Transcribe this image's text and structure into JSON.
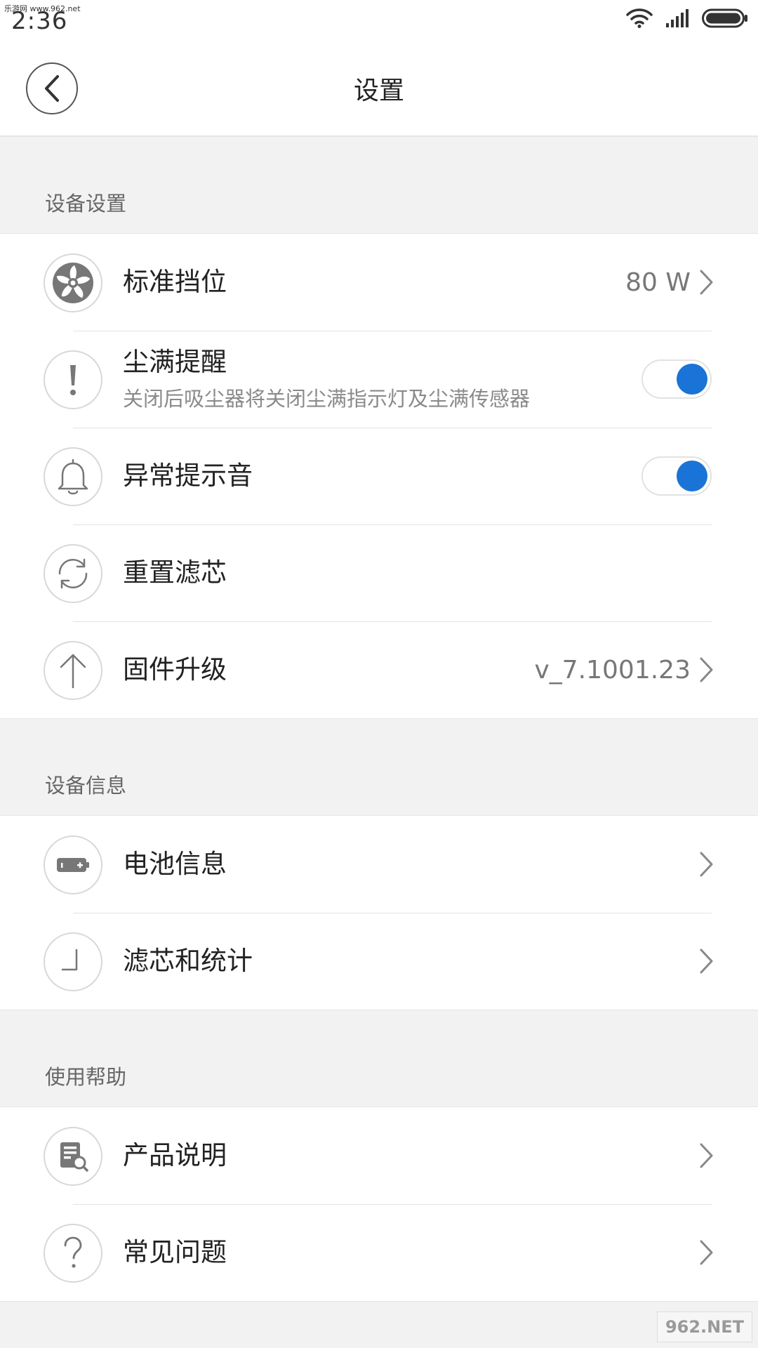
{
  "status": {
    "watermark": "乐游网 www.962.net",
    "time": "2:36"
  },
  "header": {
    "title": "设置"
  },
  "colors": {
    "accent": "#1a73d6"
  },
  "sections": [
    {
      "title": "设备设置",
      "items": [
        {
          "icon": "fan-icon",
          "label": "标准挡位",
          "value": "80 W"
        },
        {
          "icon": "alert-icon",
          "label": "尘满提醒",
          "sub": "关闭后吸尘器将关闭尘满指示灯及尘满传感器",
          "toggle": true
        },
        {
          "icon": "bell-icon",
          "label": "异常提示音",
          "toggle": true
        },
        {
          "icon": "refresh-icon",
          "label": "重置滤芯"
        },
        {
          "icon": "arrow-up-icon",
          "label": "固件升级",
          "value": "v_7.1001.23"
        }
      ]
    },
    {
      "title": "设备信息",
      "items": [
        {
          "icon": "battery-icon",
          "label": "电池信息"
        },
        {
          "icon": "clock-icon",
          "label": "滤芯和统计"
        }
      ]
    },
    {
      "title": "使用帮助",
      "items": [
        {
          "icon": "manual-search-icon",
          "label": "产品说明"
        },
        {
          "icon": "question-icon",
          "label": "常见问题"
        }
      ]
    }
  ],
  "footer": {
    "logo_text": "962.NET"
  }
}
